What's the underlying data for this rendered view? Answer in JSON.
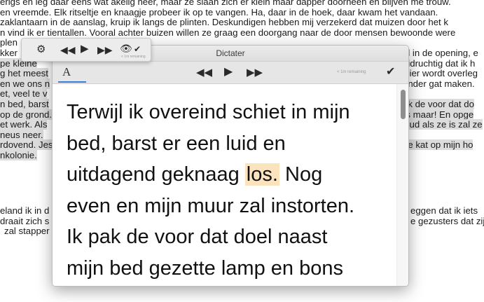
{
  "background_document": {
    "lines": [
      {
        "text": "erigs en leg daar eens wat akelig neer, maar ze slaan zich er klein maar dapper doorheen en blijven me trouw.",
        "hl": false
      },
      {
        "text": "en vreemde. Elk ritseltje en knaagje probeer ik op te vangen. Ha, daar in de hoek, daar kwam het vandaan.",
        "hl": false
      },
      {
        "text": "zaklantaarn in de aanslag, kruip ik langs de plinten. Deskundigen hebben mij verzekerd dat muizen door het k",
        "hl": false
      },
      {
        "text": "n vind ik er tientallen. Vooral achter buizen willen ze graag een doorgang naar de door mensen bewoonde were",
        "hl": false
      },
      {
        "text": "plen",
        "hl": false
      },
      {
        "text": "kker",
        "hl": false
      },
      {
        "text": "pe kleine",
        "hl": true
      },
      {
        "text": "g het meest",
        "hl": true
      },
      {
        "text": "en we ons n",
        "hl": true
      },
      {
        "text": "et, veel te v",
        "hl": true
      },
      {
        "text": "n bed, barst",
        "hl": true
      },
      {
        "text": "op de grond.",
        "hl": true
      },
      {
        "text": "et werk. Als",
        "hl": true
      },
      {
        "text": "neus neer.",
        "hl": true
      },
      {
        "text": "rdovend. Jes",
        "hl": true
      },
      {
        "text": "nkolonie.",
        "hl": true
      }
    ],
    "right_lines": [
      {
        "text": "al in de opening, e",
        "hl": false
      },
      {
        "text": "uidruchtig dat ik h",
        "hl": false
      },
      {
        "text": "Hier wordt overleg",
        "hl": false
      },
      {
        "text": "ander gat maken.",
        "hl": false
      },
      {
        "text": "",
        "hl": false
      },
      {
        "text": "ak de voor dat do",
        "hl": true
      },
      {
        "text": "rs maar! En opge",
        "hl": true
      },
      {
        "text": "Dud als ze is zal ze",
        "hl": true
      },
      {
        "text": "",
        "hl": true
      },
      {
        "text": "de kat op mijn ho",
        "hl": true
      }
    ],
    "lower_left": [
      "eland ik in d",
      "draait zich s",
      "zal stapper"
    ],
    "lower_right": [
      "eggen dat ik iets",
      "e gezusters dat zij"
    ]
  },
  "mini_toolbar": {
    "icons": [
      "gear-icon",
      "rewind-icon",
      "play-icon",
      "fast-forward-icon",
      "eye-icon",
      "checkmark-icon"
    ],
    "remaining": "< 1m remaining"
  },
  "window": {
    "title": "Dictater",
    "toolbar": {
      "font_button": "A",
      "remaining": "< 1m remaining"
    },
    "text_lines": [
      {
        "before": "Terwijl ik overeind schiet in mijn",
        "word": "",
        "after": ""
      },
      {
        "before": "bed, barst er een luid en",
        "word": "",
        "after": ""
      },
      {
        "before": "uitdagend geknaag ",
        "word": "los.",
        "after": " Nog"
      },
      {
        "before": "even en mijn muur zal instorten.",
        "word": "",
        "after": ""
      },
      {
        "before": "Ik pak de voor dat doel naast",
        "word": "",
        "after": ""
      }
    ],
    "partial_line": "mijn bed gezette lamp en bons"
  }
}
